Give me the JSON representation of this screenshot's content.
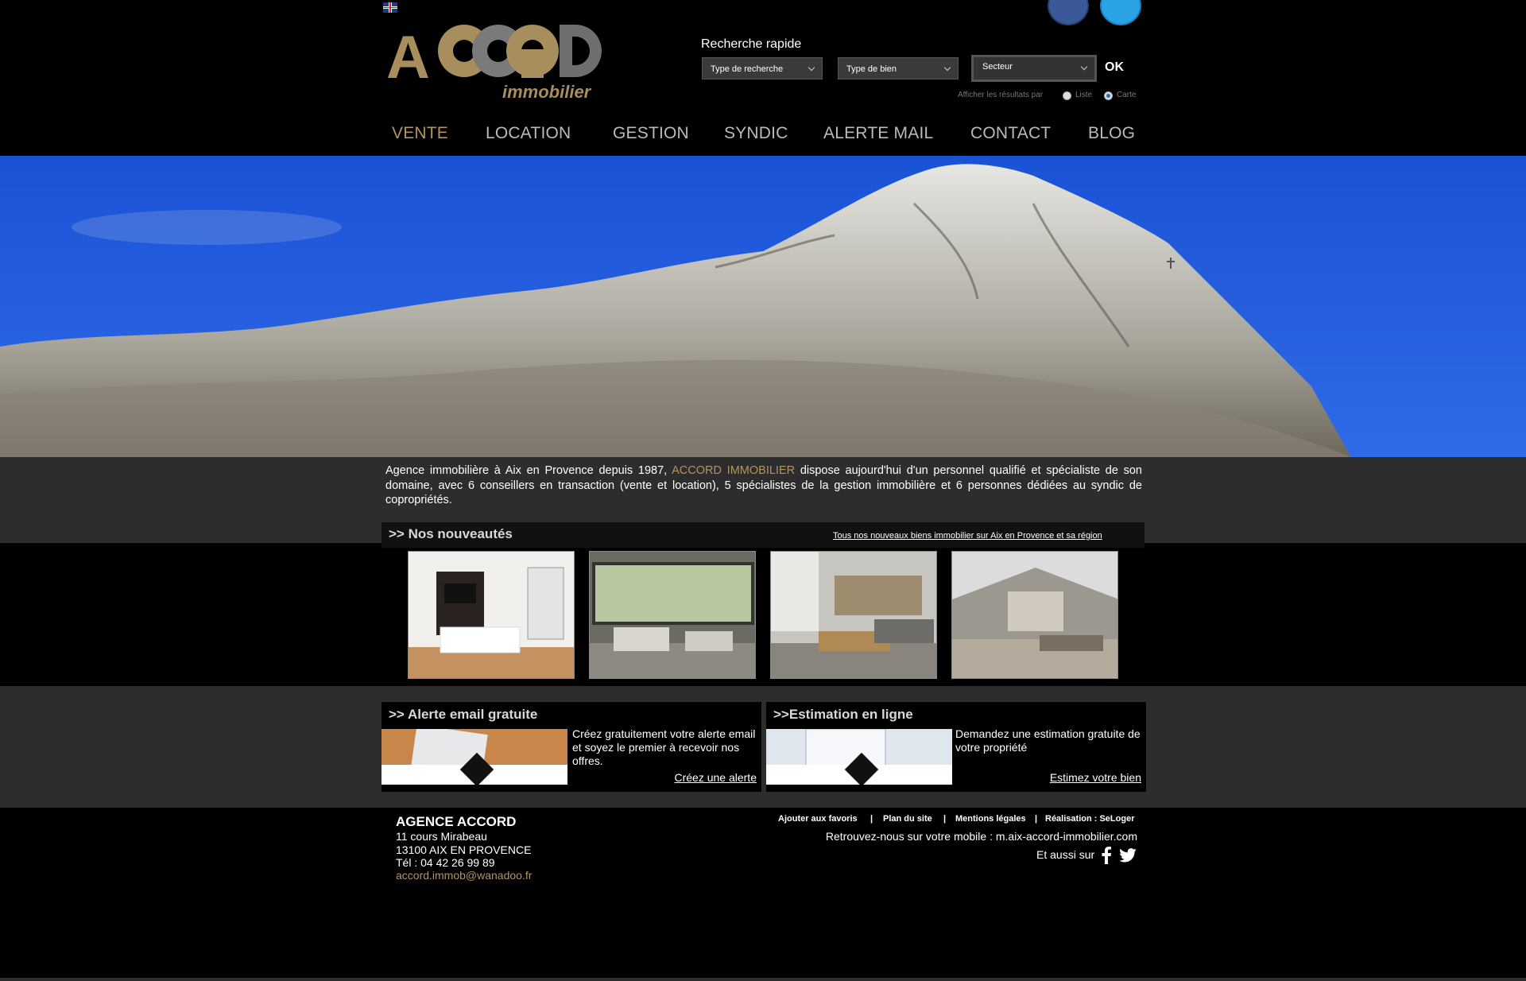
{
  "header": {
    "language_flag": "uk-flag-icon",
    "logo": {
      "word": "ACCORD",
      "sub": "immobilier"
    },
    "search": {
      "title": "Recherche rapide",
      "type_recherche": "Type de recherche",
      "type_bien": "Type de bien",
      "secteur": "Secteur",
      "ok_label": "OK",
      "display_label": "Afficher les résultats par",
      "option_liste": "Liste",
      "option_carte": "Carte"
    },
    "nav": [
      "VENTE",
      "LOCATION",
      "GESTION",
      "SYNDIC",
      "ALERTE MAIL",
      "CONTACT",
      "BLOG"
    ]
  },
  "intro": {
    "before": "Agence immobilière à Aix en Provence depuis 1987, ",
    "brand": "ACCORD IMMOBILIER",
    "after": " dispose aujourd'hui d'un personnel qualifié et spécialiste de son domaine, avec 6 conseillers en transaction (vente et location), 5 spécialistes de la gestion immobilière et 6 personnes dédiées au syndic de copropriétés."
  },
  "news": {
    "title": ">> Nos nouveautés",
    "link": "Tous nos nouveaux biens immobilier sur Aix en Provence et sa région"
  },
  "alerte": {
    "title": ">> Alerte email gratuite",
    "text": "Créez gratuitement votre alerte email et soyez le premier à recevoir nos offres.",
    "link": "Créez une alerte"
  },
  "estimation": {
    "title": ">>Estimation en ligne",
    "text": "Demandez une estimation gratuite de votre propriété",
    "link": "Estimez votre bien"
  },
  "footer": {
    "agency": "AGENCE ACCORD",
    "street": "11 cours Mirabeau",
    "city": "13100 AIX EN PROVENCE",
    "tel": "Tél : 04 42 26 99 89",
    "email": "accord.immob@wanadoo.fr",
    "links": [
      "Ajouter aux favoris",
      "Plan du site",
      "Mentions légales",
      "Réalisation : SeLoger"
    ],
    "mobile": "Retrouvez-nous sur votre mobile : m.aix-accord-immobilier.com",
    "aussi": "Et aussi sur"
  },
  "colors": {
    "accent": "#b39363",
    "panel": "#2d2d2d"
  }
}
